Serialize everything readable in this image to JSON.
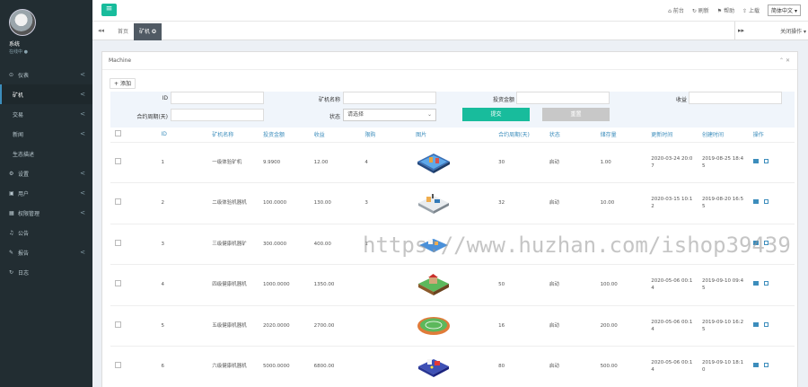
{
  "sidebar": {
    "username": "系统",
    "status": "在线中 ●",
    "items": [
      {
        "icon": "dashboard-icon",
        "glyph": "⊙",
        "label": "仪表",
        "chevron": "<"
      },
      {
        "icon": "",
        "glyph": "",
        "label": "矿机",
        "chevron": "<"
      },
      {
        "icon": "",
        "glyph": "",
        "label": "交易",
        "chevron": "<"
      },
      {
        "icon": "",
        "glyph": "",
        "label": "新闻",
        "chevron": "<"
      },
      {
        "icon": "",
        "glyph": "",
        "label": "生态描述",
        "chevron": ""
      },
      {
        "icon": "settings-icon",
        "glyph": "⚙",
        "label": "设置",
        "chevron": "<"
      },
      {
        "icon": "user-icon",
        "glyph": "▣",
        "label": "用户",
        "chevron": "<"
      },
      {
        "icon": "permission-icon",
        "glyph": "▦",
        "label": "权限管理",
        "chevron": "<"
      },
      {
        "icon": "notice-icon",
        "glyph": "♫",
        "label": "公告",
        "chevron": ""
      },
      {
        "icon": "report-icon",
        "glyph": "✎",
        "label": "报告",
        "chevron": "<"
      },
      {
        "icon": "log-icon",
        "glyph": "↻",
        "label": "日志",
        "chevron": ""
      }
    ]
  },
  "topbar": {
    "home": "前台",
    "refresh": "刷新",
    "help": "帮助",
    "upload": "上载",
    "language": "简体中文"
  },
  "tabs": {
    "home": "首页",
    "current": "矿机 ✪",
    "ops": "关闭操作 ▾"
  },
  "panel": {
    "title": "Machine",
    "controls": "⌃ ✕",
    "add": "添加"
  },
  "search": {
    "id_label": "ID",
    "name_label": "矿机名称",
    "price_label": "投资金额",
    "income_label": "收益",
    "days_label": "合约周期(天)",
    "status_label": "状态",
    "status_value": "请选择",
    "submit": "提交",
    "reset": "重置"
  },
  "table": {
    "headers": [
      "",
      "ID",
      "矿机名称",
      "投资金额",
      "收益",
      "限购",
      "图片",
      "合约周期(天)",
      "状态",
      "储存量",
      "更新时间",
      "创建时间",
      "操作"
    ],
    "rows": [
      {
        "id": "1",
        "name": "一级体验矿机",
        "price": "9.9900",
        "income": "12.00",
        "limit": "4",
        "days": "30",
        "status": "启动",
        "stock": "1.00",
        "updated": "2020-03-24 20:0\n7",
        "created": "2019-08-25 18:4\n5",
        "thumb": "blue"
      },
      {
        "id": "2",
        "name": "二级体验机器机",
        "price": "100.0000",
        "income": "130.00",
        "limit": "3",
        "days": "32",
        "status": "启动",
        "stock": "10.00",
        "updated": "2020-03-15 10:1\n2",
        "created": "2019-08-20 16:5\n5",
        "thumb": "white"
      },
      {
        "id": "3",
        "name": "三级健康机器矿",
        "price": "300.0000",
        "income": "400.00",
        "limit": "1",
        "days": "",
        "status": "",
        "stock": "",
        "updated": "",
        "created": "",
        "thumb": "partial"
      },
      {
        "id": "4",
        "name": "四级健康机器机",
        "price": "1000.0000",
        "income": "1350.00",
        "limit": "",
        "days": "50",
        "status": "启动",
        "stock": "100.00",
        "updated": "2020-05-06 00:1\n4",
        "created": "2019-09-10 09:4\n5",
        "thumb": "green"
      },
      {
        "id": "5",
        "name": "五级健康机器机",
        "price": "2020.0000",
        "income": "2700.00",
        "limit": "",
        "days": "16",
        "status": "启动",
        "stock": "200.00",
        "updated": "2020-05-06 00:1\n4",
        "created": "2019-09-10 16:2\n5",
        "thumb": "stadium"
      },
      {
        "id": "6",
        "name": "六级健康机器机",
        "price": "5000.0000",
        "income": "6800.00",
        "limit": "",
        "days": "80",
        "status": "启动",
        "stock": "500.00",
        "updated": "2020-05-06 00:1\n4",
        "created": "2019-09-10 18:1\n0",
        "thumb": "purple"
      }
    ]
  },
  "watermark": "https://www.huzhan.com/ishop39439"
}
